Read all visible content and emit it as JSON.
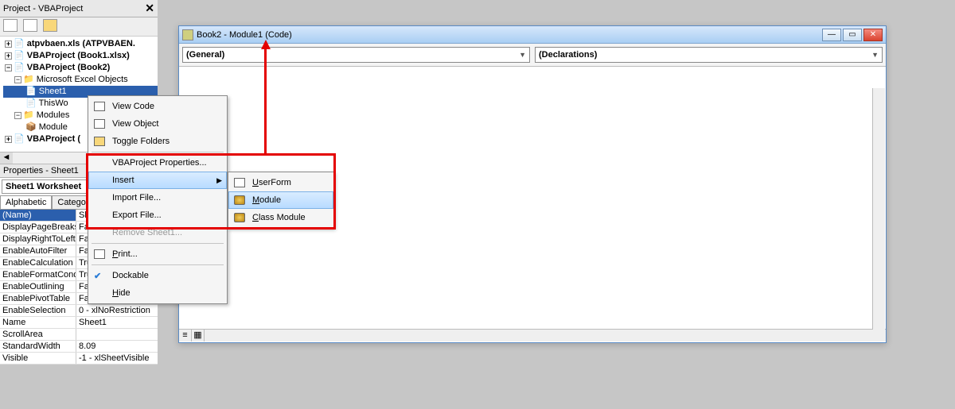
{
  "project": {
    "title": "Project - VBAProject",
    "tree": {
      "atpvbaen": "atpvbaen.xls (ATPVBAEN.",
      "book1": "VBAProject (Book1.xlsx)",
      "book2": "VBAProject (Book2)",
      "excel_objects": "Microsoft Excel Objects",
      "sheet1": "Sheet1",
      "thiswb": "ThisWo",
      "modules": "Modules",
      "module_node": "Module",
      "last": "VBAProject ("
    }
  },
  "properties": {
    "title": "Properties - Sheet1",
    "object": "Sheet1 Worksheet",
    "tabs": {
      "alpha": "Alphabetic",
      "cat": "Categorize"
    },
    "rows": [
      {
        "k": "(Name)",
        "v": "She"
      },
      {
        "k": "DisplayPageBreaks",
        "v": "Fals"
      },
      {
        "k": "DisplayRightToLeft",
        "v": "Fals"
      },
      {
        "k": "EnableAutoFilter",
        "v": "Fals"
      },
      {
        "k": "EnableCalculation",
        "v": "Tru"
      },
      {
        "k": "EnableFormatCond",
        "v": "Tru"
      },
      {
        "k": "EnableOutlining",
        "v": "False"
      },
      {
        "k": "EnablePivotTable",
        "v": "False"
      },
      {
        "k": "EnableSelection",
        "v": "0 - xlNoRestriction"
      },
      {
        "k": "Name",
        "v": "Sheet1"
      },
      {
        "k": "ScrollArea",
        "v": ""
      },
      {
        "k": "StandardWidth",
        "v": "8.09"
      },
      {
        "k": "Visible",
        "v": "-1 - xlSheetVisible"
      }
    ]
  },
  "code_window": {
    "title": "Book2 - Module1 (Code)",
    "combo_left": "(General)",
    "combo_right": "(Declarations)"
  },
  "context_menu": {
    "view_code": "View Code",
    "view_object": "View Object",
    "toggle_folders": "Toggle Folders",
    "vba_props": "VBAProject Properties...",
    "insert": "Insert",
    "import": "Import File...",
    "export": "Export File...",
    "remove": "Remove Sheet1...",
    "print": "Print...",
    "dockable": "Dockable",
    "hide": "Hide",
    "sub": {
      "userform": "UserForm",
      "module": "Module",
      "class_module": "Class Module"
    }
  }
}
